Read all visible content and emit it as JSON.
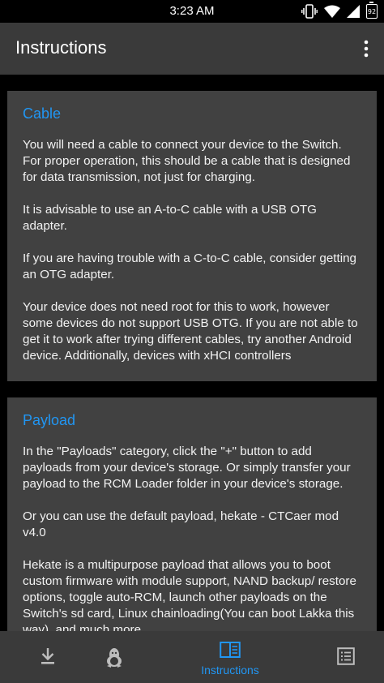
{
  "status_bar": {
    "time": "3:23 AM",
    "battery": "92"
  },
  "app_bar": {
    "title": "Instructions"
  },
  "cards": [
    {
      "title": "Cable",
      "paragraphs": [
        "You will need a cable to connect your device to the Switch. For proper operation, this should be a cable that is designed for data transmission, not just for charging.",
        "It is advisable to use an A-to-C cable with a USB OTG adapter.",
        "If you are having trouble with a C-to-C cable, consider getting an OTG adapter.",
        "Your device does not need root for this to work, however some devices do not support USB OTG. If you are not able to get it to work after trying different cables, try another Android device. Additionally, devices with xHCI controllers"
      ]
    },
    {
      "title": "Payload",
      "paragraphs": [
        "In the \"Payloads\" category, click the \"+\" button to add payloads from your device's storage. Or simply transfer your payload to the RCM Loader folder in your device's storage.",
        "Or you can use the default payload, hekate - CTCaer mod v4.0",
        "Hekate is a multipurpose payload that allows you to boot custom firmware with module support, NAND backup/ restore options, toggle auto-RCM, launch other payloads on the Switch's sd card, Linux chainloading(You can boot Lakka this way), and much more."
      ]
    }
  ],
  "bottom_nav": {
    "items": [
      {
        "icon": "download-icon",
        "label": ""
      },
      {
        "icon": "linux-penguin-icon",
        "label": ""
      },
      {
        "icon": "book-icon",
        "label": "Instructions"
      },
      {
        "icon": "list-icon",
        "label": ""
      }
    ],
    "active_color": "#2196f3"
  }
}
